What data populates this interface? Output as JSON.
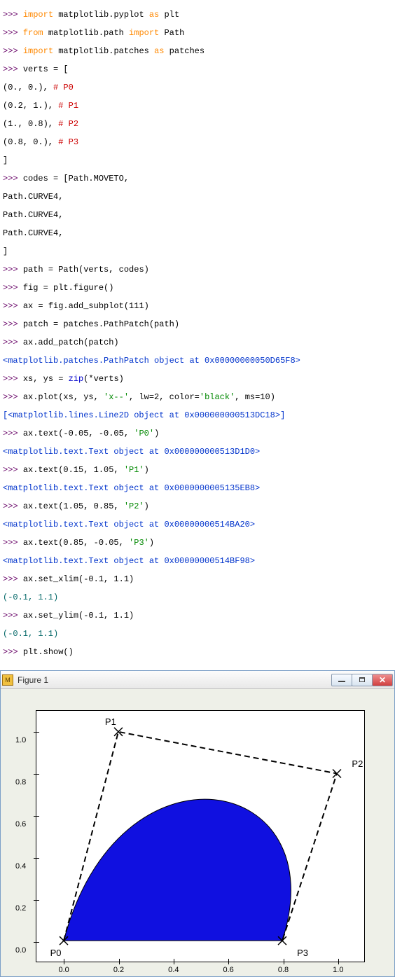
{
  "code": {
    "l1_prompt": ">>> ",
    "l1_kw": "import",
    "l1_rest": " matplotlib.pyplot ",
    "l1_as": "as",
    "l1_alias": " plt",
    "l2_prompt": ">>> ",
    "l2_kw": "from",
    "l2_mod": " matplotlib.path ",
    "l2_imp": "import",
    "l2_name": " Path",
    "l3_prompt": ">>> ",
    "l3_kw": "import",
    "l3_rest": " matplotlib.patches ",
    "l3_as": "as",
    "l3_alias": " patches",
    "l4_prompt": ">>> ",
    "l4_text": "verts = [",
    "l5": "(0., 0.), ",
    "l5c": "# P0",
    "l6": "(0.2, 1.), ",
    "l6c": "# P1",
    "l7": "(1., 0.8), ",
    "l7c": "# P2",
    "l8": "(0.8, 0.), ",
    "l8c": "# P3",
    "l9": "]",
    "l10_prompt": ">>> ",
    "l10_text": "codes = [Path.MOVETO,",
    "l11": "Path.CURVE4,",
    "l12": "Path.CURVE4,",
    "l13": "Path.CURVE4,",
    "l14": "]",
    "l15_prompt": ">>> ",
    "l15_text": "path = Path(verts, codes)",
    "l16_prompt": ">>> ",
    "l16_text": "fig = plt.figure()",
    "l17_prompt": ">>> ",
    "l17_text": "ax = fig.add_subplot(111)",
    "l18_prompt": ">>> ",
    "l18_text": "patch = patches.PathPatch(path)",
    "l19_prompt": ">>> ",
    "l19_text": "ax.add_patch(patch)",
    "l20": "<matplotlib.patches.PathPatch object at 0x00000000050D65F8>",
    "l21_prompt": ">>> ",
    "l21a": "xs, ys = ",
    "l21b": "zip",
    "l21c": "(*verts)",
    "l22_prompt": ">>> ",
    "l22a": "ax.plot(xs, ys, ",
    "l22s1": "'x--'",
    "l22b": ", lw=2, color=",
    "l22s2": "'black'",
    "l22c": ", ms=10)",
    "l23": "[<matplotlib.lines.Line2D object at 0x000000000513DC18>]",
    "l24_prompt": ">>> ",
    "l24a": "ax.text(-0.05, -0.05, ",
    "l24s": "'P0'",
    "l24b": ")",
    "l25": "<matplotlib.text.Text object at 0x000000000513D1D0>",
    "l26_prompt": ">>> ",
    "l26a": "ax.text(0.15, 1.05, ",
    "l26s": "'P1'",
    "l26b": ")",
    "l27": "<matplotlib.text.Text object at 0x0000000005135EB8>",
    "l28_prompt": ">>> ",
    "l28a": "ax.text(1.05, 0.85, ",
    "l28s": "'P2'",
    "l28b": ")",
    "l29": "<matplotlib.text.Text object at 0x00000000514BA20>",
    "l30_prompt": ">>> ",
    "l30a": "ax.text(0.85, -0.05, ",
    "l30s": "'P3'",
    "l30b": ")",
    "l31": "<matplotlib.text.Text object at 0x00000000514BF98>",
    "l32_prompt": ">>> ",
    "l32_text": "ax.set_xlim(-0.1, 1.1)",
    "l33": "(-0.1, 1.1)",
    "l34_prompt": ">>> ",
    "l34_text": "ax.set_ylim(-0.1, 1.1)",
    "l35": "(-0.1, 1.1)",
    "l36_prompt": ">>> ",
    "l36_text": "plt.show()"
  },
  "window": {
    "title": "Figure 1"
  },
  "chart_data": {
    "type": "line",
    "x": [
      0.0,
      0.2,
      1.0,
      0.8
    ],
    "y": [
      0.0,
      1.0,
      0.8,
      0.0
    ],
    "xlim": [
      -0.1,
      1.1
    ],
    "ylim": [
      -0.1,
      1.1
    ],
    "xticks": [
      0.0,
      0.2,
      0.4,
      0.6,
      0.8,
      1.0
    ],
    "yticks": [
      0.0,
      0.2,
      0.4,
      0.6,
      0.8,
      1.0
    ],
    "xtick_labels": [
      "0.0",
      "0.2",
      "0.4",
      "0.6",
      "0.8",
      "1.0"
    ],
    "ytick_labels": [
      "0.0",
      "0.2",
      "0.4",
      "0.6",
      "0.8",
      "1.0"
    ],
    "point_labels": [
      {
        "text": "P0",
        "x": -0.05,
        "y": -0.05
      },
      {
        "text": "P1",
        "x": 0.15,
        "y": 1.05
      },
      {
        "text": "P2",
        "x": 1.05,
        "y": 0.85
      },
      {
        "text": "P3",
        "x": 0.85,
        "y": -0.05
      }
    ],
    "bezier_patch": {
      "p0": [
        0,
        0
      ],
      "p1": [
        0.2,
        1.0
      ],
      "p2": [
        1.0,
        0.8
      ],
      "p3": [
        0.8,
        0.0
      ],
      "fill": "#1010e0"
    },
    "line_style": "dashed",
    "marker": "x",
    "line_color": "#000000"
  }
}
